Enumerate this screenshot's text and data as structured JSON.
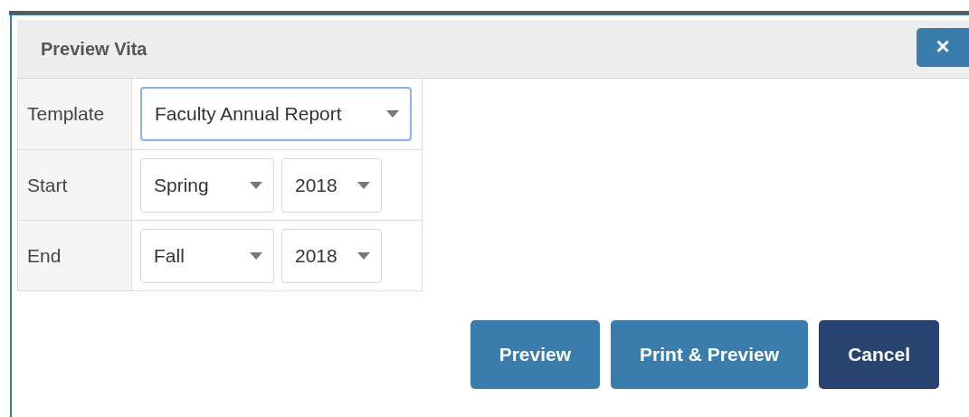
{
  "dialog": {
    "title": "Preview Vita",
    "close_label": "×"
  },
  "rows": [
    {
      "label": "Template",
      "selects": [
        {
          "value": "Faculty Annual Report",
          "focused": true
        }
      ]
    },
    {
      "label": "Start",
      "selects": [
        {
          "value": "Spring",
          "focused": false
        },
        {
          "value": "2018",
          "focused": false
        }
      ]
    },
    {
      "label": "End",
      "selects": [
        {
          "value": "Fall",
          "focused": false
        },
        {
          "value": "2018",
          "focused": false
        }
      ]
    }
  ],
  "buttons": [
    {
      "label": "Preview",
      "kind": "primary"
    },
    {
      "label": "Print & Preview",
      "kind": "primary"
    },
    {
      "label": "Cancel",
      "kind": "dark"
    }
  ]
}
